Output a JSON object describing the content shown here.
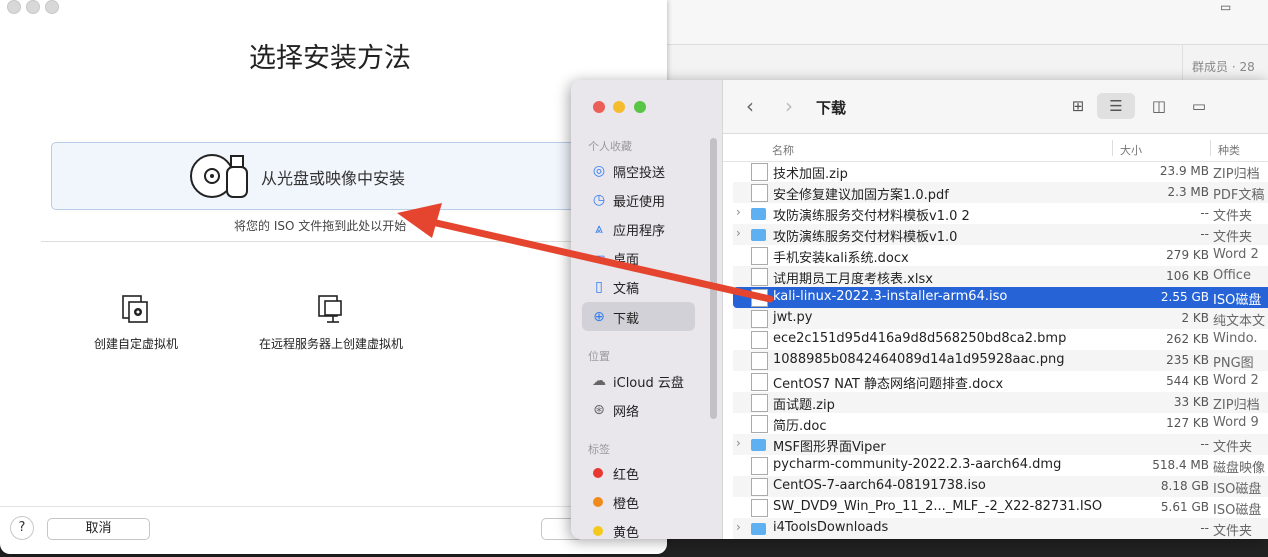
{
  "background_window": {
    "members_label": "群成员 · 28",
    "corner_icon": "video-icon"
  },
  "vm_dialog": {
    "title": "选择安装方法",
    "install_from_disc": "从光盘或映像中安装",
    "drag_hint": "将您的 ISO 文件拖到此处以开始",
    "options": [
      {
        "label": "创建自定虚拟机",
        "icon": "custom-vm-icon"
      },
      {
        "label": "在远程服务器上创建虚拟机",
        "icon": "remote-server-icon"
      }
    ],
    "help_label": "?",
    "cancel_label": "取消"
  },
  "finder": {
    "location": "下载",
    "nav_back": "‹",
    "nav_forward": "›",
    "sidebar": {
      "favorites_header": "个人收藏",
      "favorites": [
        {
          "label": "隔空投送",
          "icon": "airdrop-icon"
        },
        {
          "label": "最近使用",
          "icon": "clock-icon"
        },
        {
          "label": "应用程序",
          "icon": "applications-icon"
        },
        {
          "label": "桌面",
          "icon": "desktop-icon"
        },
        {
          "label": "文稿",
          "icon": "document-icon"
        },
        {
          "label": "下载",
          "icon": "download-icon",
          "selected": true
        }
      ],
      "locations_header": "位置",
      "locations": [
        {
          "label": "iCloud 云盘",
          "icon": "cloud-icon"
        },
        {
          "label": "网络",
          "icon": "network-icon"
        }
      ],
      "tags_header": "标签",
      "tags": [
        {
          "label": "红色",
          "color": "#e8382f"
        },
        {
          "label": "橙色",
          "color": "#f08a1c"
        },
        {
          "label": "黄色",
          "color": "#f5c91b"
        }
      ]
    },
    "columns": {
      "name": "名称",
      "size": "大小",
      "kind": "种类"
    },
    "files": [
      {
        "name": "技术加固.zip",
        "size": "23.9 MB",
        "kind": "ZIP归档",
        "type": "file"
      },
      {
        "name": "安全修复建议加固方案1.0.pdf",
        "size": "2.3 MB",
        "kind": "PDF文稿",
        "type": "file"
      },
      {
        "name": "攻防演练服务交付材料模板v1.0 2",
        "size": "--",
        "kind": "文件夹",
        "type": "folder"
      },
      {
        "name": "攻防演练服务交付材料模板v1.0",
        "size": "--",
        "kind": "文件夹",
        "type": "folder"
      },
      {
        "name": "手机安装kali系统.docx",
        "size": "279 KB",
        "kind": "Word 2",
        "type": "file"
      },
      {
        "name": "试用期员工月度考核表.xlsx",
        "size": "106 KB",
        "kind": "Office",
        "type": "file"
      },
      {
        "name": "kali-linux-2022.3-installer-arm64.iso",
        "size": "2.55 GB",
        "kind": "ISO磁盘",
        "type": "file",
        "selected": true
      },
      {
        "name": "jwt.py",
        "size": "2 KB",
        "kind": "纯文本文",
        "type": "file"
      },
      {
        "name": "ece2c151d95d416a9d8d568250bd8ca2.bmp",
        "size": "262 KB",
        "kind": "Windo.",
        "type": "file"
      },
      {
        "name": "1088985b0842464089d14a1d95928aac.png",
        "size": "235 KB",
        "kind": "PNG图",
        "type": "file"
      },
      {
        "name": "CentOS7 NAT 静态网络问题排查.docx",
        "size": "544 KB",
        "kind": "Word 2",
        "type": "file"
      },
      {
        "name": "面试题.zip",
        "size": "33 KB",
        "kind": "ZIP归档",
        "type": "file"
      },
      {
        "name": "简历.doc",
        "size": "127 KB",
        "kind": "Word 9",
        "type": "file"
      },
      {
        "name": "MSF图形界面Viper",
        "size": "--",
        "kind": "文件夹",
        "type": "folder"
      },
      {
        "name": "pycharm-community-2022.2.3-aarch64.dmg",
        "size": "518.4 MB",
        "kind": "磁盘映像",
        "type": "file"
      },
      {
        "name": "CentOS-7-aarch64-08191738.iso",
        "size": "8.18 GB",
        "kind": "ISO磁盘",
        "type": "file"
      },
      {
        "name": "SW_DVD9_Win_Pro_11_2..._MLF_-2_X22-82731.ISO",
        "size": "5.61 GB",
        "kind": "ISO磁盘",
        "type": "file"
      },
      {
        "name": "i4ToolsDownloads",
        "size": "--",
        "kind": "文件夹",
        "type": "folder"
      }
    ]
  },
  "colors": {
    "selection": "#2563d6",
    "arrow": "#e5452e",
    "folder": "#5fb0f0"
  }
}
